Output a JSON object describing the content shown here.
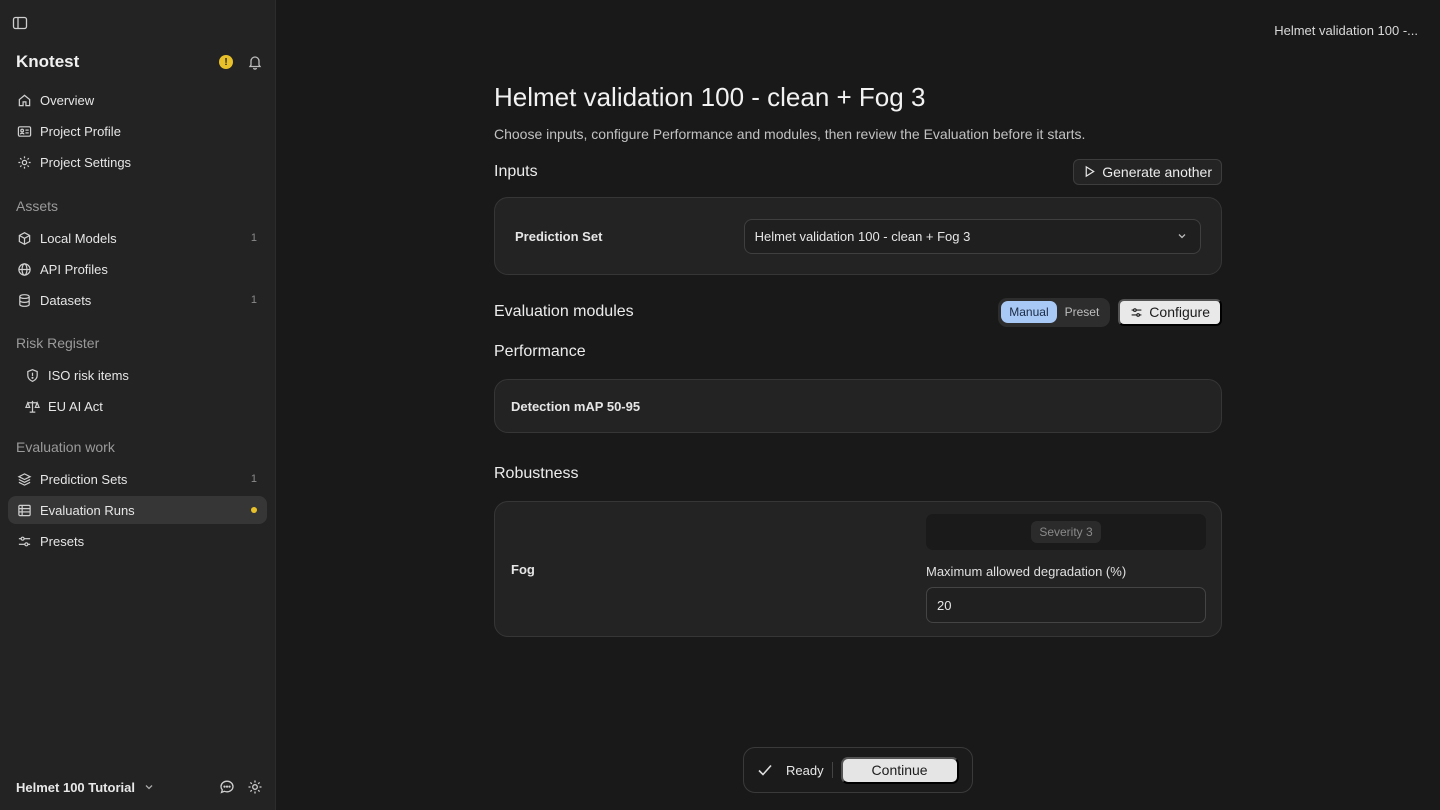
{
  "sidebar": {
    "workspace": "Knotest",
    "warning_badge": "!",
    "top_items": [
      {
        "label": "Overview",
        "icon": "home-icon"
      },
      {
        "label": "Project Profile",
        "icon": "id-card-icon"
      },
      {
        "label": "Project Settings",
        "icon": "gear-icon"
      }
    ],
    "sections": {
      "assets": "Assets",
      "risk": "Risk Register",
      "eval": "Evaluation work"
    },
    "assets_items": [
      {
        "label": "Local Models",
        "count": "1",
        "icon": "cube-icon"
      },
      {
        "label": "API Profiles",
        "count": "",
        "icon": "globe-icon"
      },
      {
        "label": "Datasets",
        "count": "1",
        "icon": "database-icon"
      }
    ],
    "risk_items": [
      {
        "label": "ISO risk items",
        "icon": "shield-icon"
      },
      {
        "label": "EU AI Act",
        "icon": "scale-icon"
      }
    ],
    "eval_items": [
      {
        "label": "Prediction Sets",
        "count": "1",
        "icon": "layers-icon"
      },
      {
        "label": "Evaluation Runs",
        "count": "",
        "icon": "table-icon",
        "active": true
      },
      {
        "label": "Presets",
        "count": "",
        "icon": "sliders-icon"
      }
    ],
    "project": "Helmet 100 Tutorial"
  },
  "header": {
    "breadcrumb": "Helmet validation 100 -..."
  },
  "page": {
    "title": "Helmet validation 100 - clean + Fog 3",
    "subtitle": "Choose inputs, configure Performance and modules, then review the Evaluation before it starts."
  },
  "inputs": {
    "heading": "Inputs",
    "generate_label": "Generate another",
    "prediction_set_label": "Prediction Set",
    "prediction_set_value": "Helmet validation 100 - clean + Fog 3"
  },
  "modules": {
    "heading": "Evaluation modules",
    "mode_manual": "Manual",
    "mode_preset": "Preset",
    "selected_mode": "Manual",
    "configure_label": "Configure"
  },
  "performance": {
    "heading": "Performance",
    "metric": "Detection mAP 50-95"
  },
  "robustness": {
    "heading": "Robustness",
    "name": "Fog",
    "severity": "Severity 3",
    "degradation_label": "Maximum allowed degradation (%)",
    "degradation_value": "20"
  },
  "footer_bar": {
    "status": "Ready",
    "continue_label": "Continue"
  },
  "colors": {
    "accent_blue": "#a8c8f5",
    "warning_yellow": "#e8c12a",
    "background": "#191919",
    "sidebar": "#232323"
  }
}
